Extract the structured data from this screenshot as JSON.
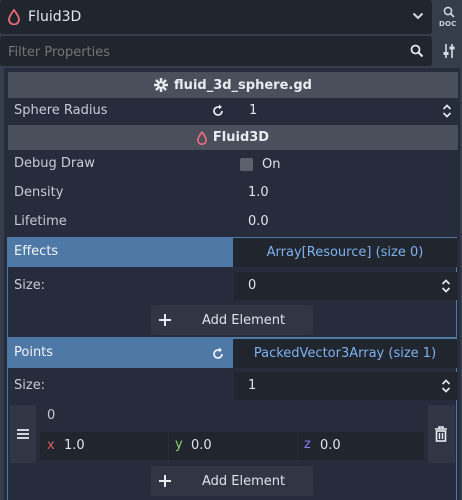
{
  "topbar": {
    "node_name": "Fluid3D",
    "doc_label": "DOC"
  },
  "filter": {
    "placeholder": "Filter Properties"
  },
  "script_section": {
    "title": "fluid_3d_sphere.gd"
  },
  "props_script": [
    {
      "label": "Sphere Radius",
      "value": "1"
    }
  ],
  "class_section": {
    "title": "Fluid3D"
  },
  "debug_draw": {
    "label": "Debug Draw",
    "checkbox_label": "On",
    "checked": false
  },
  "props_class": [
    {
      "label": "Density",
      "value": "1.0"
    },
    {
      "label": "Lifetime",
      "value": "0.0"
    }
  ],
  "effects": {
    "label": "Effects",
    "type_label": "Array[Resource] (size 0)",
    "size_label": "Size:",
    "size_value": "0",
    "add_label": "Add Element"
  },
  "points": {
    "label": "Points",
    "type_label": "PackedVector3Array (size 1)",
    "size_label": "Size:",
    "size_value": "1",
    "index_label": "0",
    "x_label": "x",
    "x_value": "1.0",
    "y_label": "y",
    "y_value": "0.0",
    "z_label": "z",
    "z_value": "0.0",
    "add_label": "Add Element"
  },
  "colors": {
    "accent": "#4e79a7",
    "x_axis": "#e05a5a",
    "y_axis": "#8fd16f",
    "z_axis": "#8a7ff5",
    "fluid_icon": "#f26b7a"
  }
}
